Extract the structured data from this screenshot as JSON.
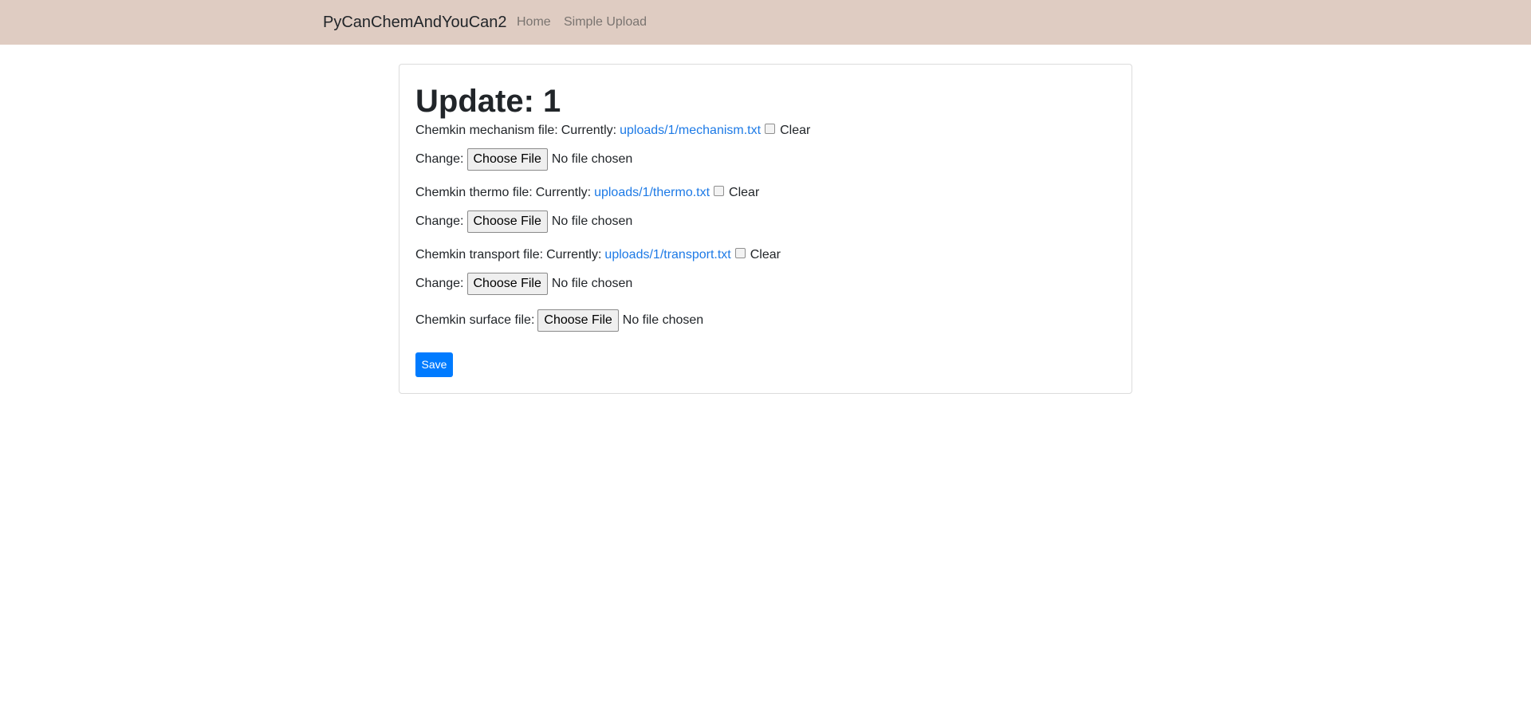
{
  "navbar": {
    "brand": "PyCanChemAndYouCan2",
    "links": [
      {
        "label": "Home"
      },
      {
        "label": "Simple Upload"
      }
    ],
    "background": "#dfccc2"
  },
  "form": {
    "title": "Update: 1",
    "fields": [
      {
        "label": "Chemkin mechanism file:",
        "currently_label": "Currently:",
        "current_file": "uploads/1/mechanism.txt",
        "clear_label": "Clear",
        "change_label": "Change:",
        "button_label": "Choose File",
        "status": "No file chosen"
      },
      {
        "label": "Chemkin thermo file:",
        "currently_label": "Currently:",
        "current_file": "uploads/1/thermo.txt",
        "clear_label": "Clear",
        "change_label": "Change:",
        "button_label": "Choose File",
        "status": "No file chosen"
      },
      {
        "label": "Chemkin transport file:",
        "currently_label": "Currently:",
        "current_file": "uploads/1/transport.txt",
        "clear_label": "Clear",
        "change_label": "Change:",
        "button_label": "Choose File",
        "status": "No file chosen"
      }
    ],
    "surface": {
      "label": "Chemkin surface file:",
      "button_label": "Choose File",
      "status": "No file chosen"
    },
    "save_label": "Save",
    "accent": "#007bff",
    "link_color": "#1d7ae6"
  }
}
